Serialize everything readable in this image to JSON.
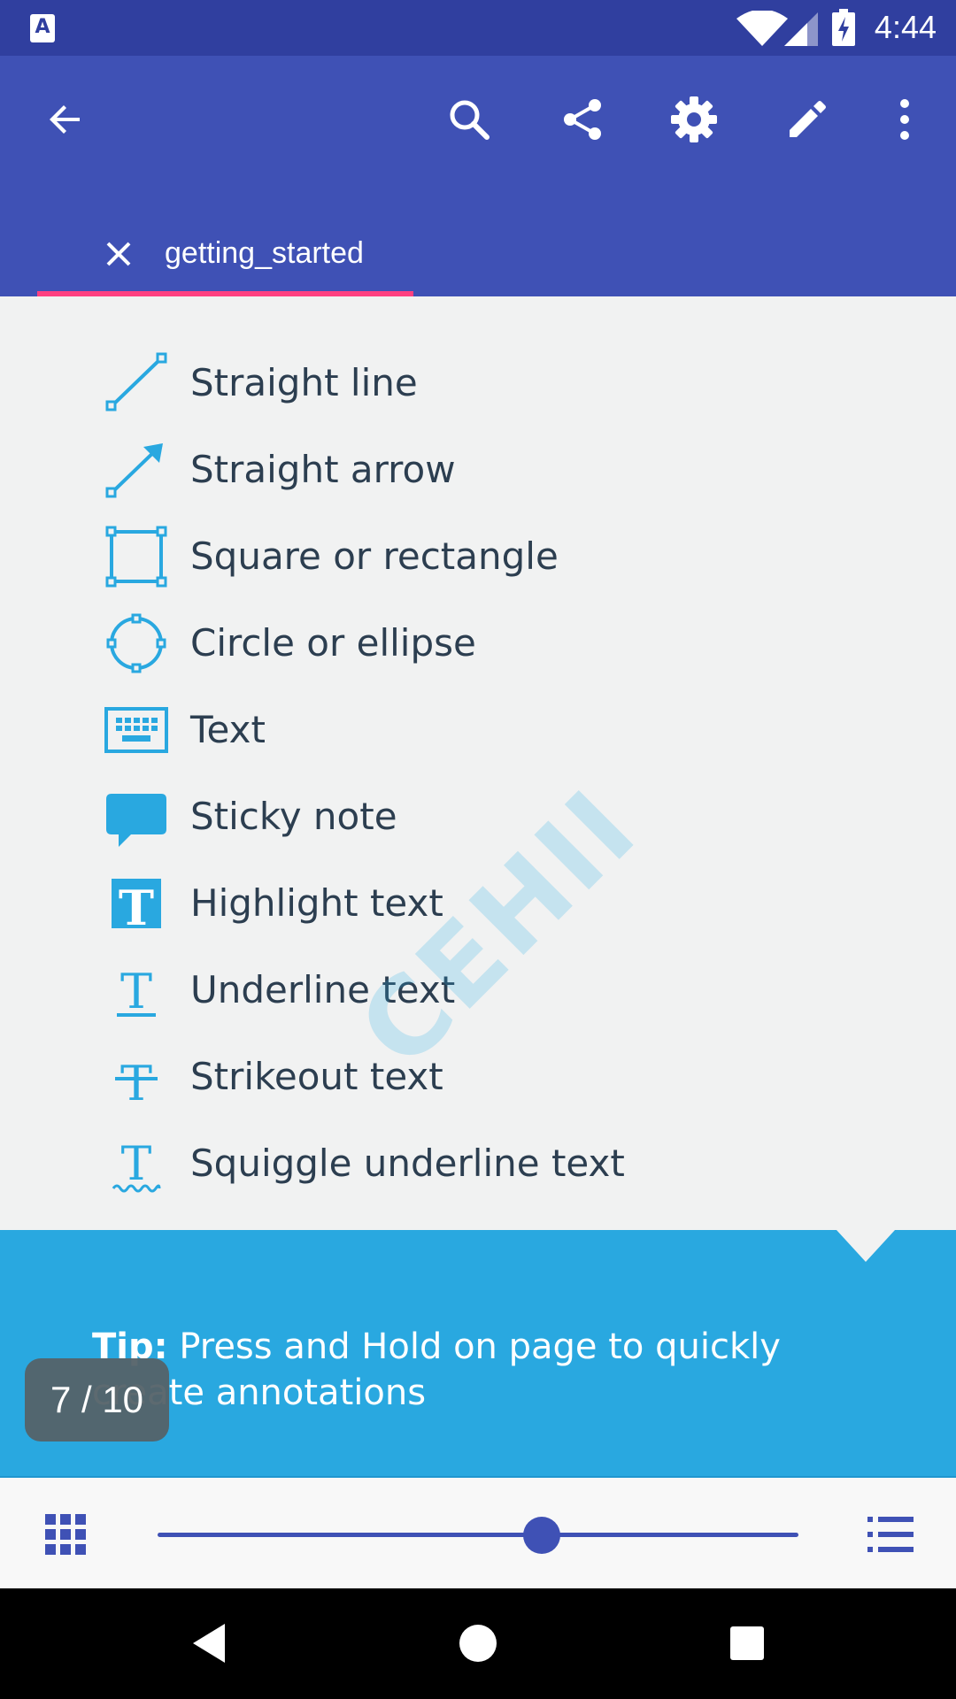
{
  "status_bar": {
    "time": "4:44",
    "app_badge": "A",
    "icons": [
      "wifi-icon",
      "cell-signal-icon",
      "battery-charging-icon"
    ]
  },
  "app_bar": {
    "actions": [
      "back-arrow-icon",
      "search-icon",
      "share-icon",
      "settings-gear-icon",
      "edit-pencil-icon",
      "more-vert-icon"
    ],
    "tab": {
      "label": "getting_started",
      "close_icon": "close-icon"
    },
    "accent": "#ff4081",
    "background": "#3f51b5"
  },
  "content": {
    "tools": [
      {
        "icon": "straight-line-icon",
        "label": "Straight line"
      },
      {
        "icon": "straight-arrow-icon",
        "label": "Straight arrow"
      },
      {
        "icon": "rectangle-icon",
        "label": "Square or rectangle"
      },
      {
        "icon": "ellipse-icon",
        "label": "Circle or ellipse"
      },
      {
        "icon": "keyboard-icon",
        "label": "Text"
      },
      {
        "icon": "sticky-note-icon",
        "label": "Sticky note"
      },
      {
        "icon": "highlight-text-icon",
        "label": "Highlight text"
      },
      {
        "icon": "underline-text-icon",
        "label": "Underline text"
      },
      {
        "icon": "strikeout-text-icon",
        "label": "Strikeout text"
      },
      {
        "icon": "squiggle-underline-icon",
        "label": "Squiggle underline text"
      }
    ],
    "watermark": "CEHII",
    "icon_color": "#29a8e0"
  },
  "tip": {
    "label": "Tip:",
    "text": " Press and Hold on page to quickly create annotations",
    "background": "#29a8e0"
  },
  "page_indicator": {
    "text": "7 / 10",
    "current": 7,
    "total": 10
  },
  "bottom_toolbar": {
    "left_icon": "thumbnails-grid-icon",
    "right_icon": "outline-list-icon",
    "slider_position": 0.6
  },
  "nav_bar": {
    "icons": [
      "back-triangle-icon",
      "home-circle-icon",
      "recents-square-icon"
    ]
  }
}
